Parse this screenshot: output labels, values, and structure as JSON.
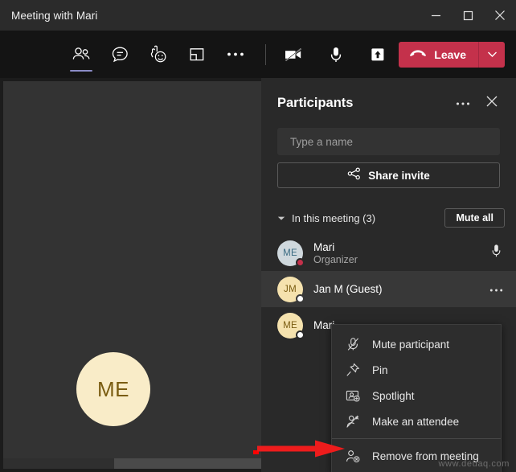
{
  "window": {
    "title": "Meeting with Mari",
    "controls": [
      {
        "name": "minimize",
        "glyph": "minimize-icon"
      },
      {
        "name": "maximize",
        "glyph": "maximize-icon"
      },
      {
        "name": "close",
        "glyph": "close-icon"
      }
    ]
  },
  "toolbar": {
    "left_items": [
      {
        "name": "people-icon",
        "label": "People",
        "active": true
      },
      {
        "name": "chat-icon",
        "label": "Chat",
        "active": false
      },
      {
        "name": "reactions-icon",
        "label": "Reactions",
        "active": false
      },
      {
        "name": "share-tray-icon",
        "label": "Share",
        "active": false
      },
      {
        "name": "more-options-icon",
        "label": "More actions",
        "active": false
      }
    ],
    "right_items": [
      {
        "name": "camera-off-icon",
        "label": "Camera off"
      },
      {
        "name": "microphone-icon",
        "label": "Microphone"
      },
      {
        "name": "share-screen-icon",
        "label": "Share screen"
      }
    ],
    "leave_label": "Leave",
    "leave_color": "#c4314b"
  },
  "stage": {
    "avatar_initials": "ME",
    "avatar_bg": "#f9ecc8",
    "avatar_fg": "#7a5c11"
  },
  "panel": {
    "title": "Participants",
    "more_label": "More options",
    "close_label": "Close",
    "search": {
      "placeholder": "Type a name",
      "value": ""
    },
    "share_invite_label": "Share invite",
    "section": {
      "label": "In this meeting (3)",
      "mute_all_label": "Mute all"
    },
    "participants": [
      {
        "initials": "ME",
        "name": "Mari",
        "role": "Organizer",
        "avatar_bg": "#cfd8dd",
        "avatar_fg": "#3a6b82",
        "presence": "#c4314b",
        "action": "microphone-icon",
        "selected": false
      },
      {
        "initials": "JM",
        "name": "Jan M (Guest)",
        "role": "",
        "avatar_bg": "#f5e2ae",
        "avatar_fg": "#7a5c11",
        "presence": "#ffffff",
        "action": "more-options-icon",
        "selected": true
      },
      {
        "initials": "ME",
        "name": "Mari",
        "role": "",
        "avatar_bg": "#f5e2ae",
        "avatar_fg": "#7a5c11",
        "presence": "#ffffff",
        "action": "",
        "selected": false
      }
    ]
  },
  "context_menu": {
    "items": [
      {
        "icon": "mic-off-icon",
        "label": "Mute participant"
      },
      {
        "icon": "pin-icon",
        "label": "Pin"
      },
      {
        "icon": "spotlight-icon",
        "label": "Spotlight"
      },
      {
        "icon": "make-attendee-icon",
        "label": "Make an attendee"
      },
      {
        "icon": "remove-person-icon",
        "label": "Remove from meeting"
      }
    ],
    "separator_before_index": 4
  },
  "annotation": {
    "arrow_color": "#ee1c1c",
    "points_to": "Remove from meeting"
  },
  "watermark": "www.deuaq.com"
}
